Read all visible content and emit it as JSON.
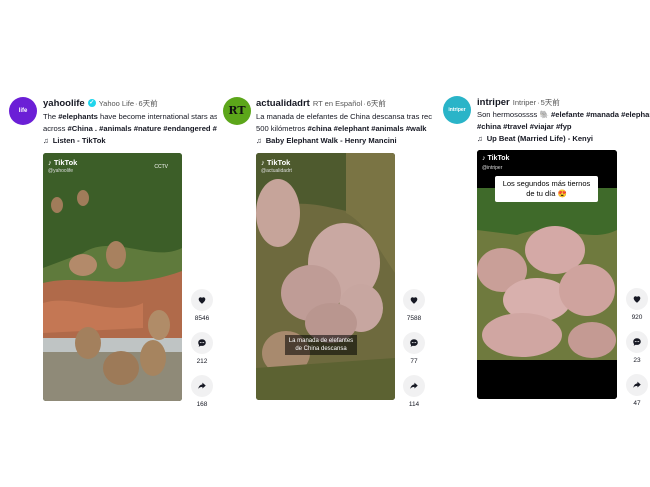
{
  "posts": [
    {
      "username": "yahoolife",
      "display": "Yahoo Life",
      "age": "6天前",
      "avatar_text": "life",
      "avatar_color": "#6b1fd6",
      "desc_pre": "The ",
      "desc_tag1": "#elephants",
      "desc_mid": " have become international stars as",
      "desc_line2_pre": "across ",
      "desc_line2_tags": "#China . #animals #nature #endangered #",
      "music": "Listen - TikTok",
      "video_watermark": "TikTok",
      "video_handle": "@yahoolife",
      "video_badge": "CCTV",
      "likes": "8546",
      "comments": "212",
      "shares": "168"
    },
    {
      "username": "actualidadrt",
      "display": "RT en Español",
      "age": "6天前",
      "avatar_text": "RT",
      "avatar_color": "#5ca61a",
      "desc_line1": "La manada de elefantes de China descansa tras rec",
      "desc_line2_pre": "500 kilómetros ",
      "desc_line2_tags": "#china #elephant #animals #walk",
      "music": "Baby Elephant Walk - Henry Mancini",
      "video_watermark": "TikTok",
      "video_handle": "@actualidadrt",
      "video_caption": "La manada de elefantes de China descansa",
      "likes": "7588",
      "comments": "77",
      "shares": "114"
    },
    {
      "username": "intriper",
      "display": "Intriper",
      "age": "5天前",
      "avatar_text": "intriper",
      "avatar_color": "#2ab4c8",
      "desc_line1_pre": "Son hermosossss 🐘 ",
      "desc_line1_tags": "#elefante #manada #elephant",
      "desc_line2_tags": "#china #travel #viajar #fyp",
      "music": "Up Beat (Married Life) - Kenyi",
      "video_watermark": "TikTok",
      "video_handle": "@intriper",
      "video_caption": "Los segundos más tiernos de tu día 😍",
      "likes": "920",
      "comments": "23",
      "shares": "47"
    }
  ]
}
